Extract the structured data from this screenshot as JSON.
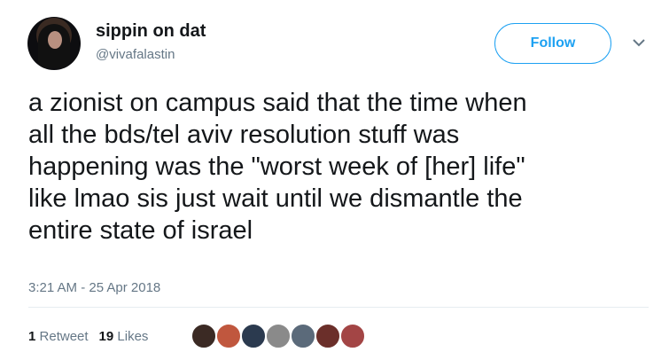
{
  "author": {
    "display_name": "sippin on dat",
    "handle": "@vivafalastin"
  },
  "follow_button": {
    "label": "Follow"
  },
  "tweet": {
    "text": "a zionist on campus said that the time when\nall the bds/tel aviv resolution stuff was\nhappening was the \"worst week of [her] life\"\nlike lmao sis just wait until we dismantle the\nentire state of israel",
    "timestamp": "3:21 AM - 25 Apr 2018"
  },
  "stats": {
    "retweets_count": "1",
    "retweets_label": "Retweet",
    "likes_count": "19",
    "likes_label": "Likes"
  },
  "likers": [
    {
      "name": "liker-avatar-1",
      "color": "#3b2a24"
    },
    {
      "name": "liker-avatar-2",
      "color": "#c0573e"
    },
    {
      "name": "liker-avatar-3",
      "color": "#2b3a4f"
    },
    {
      "name": "liker-avatar-4",
      "color": "#8a8a8a"
    },
    {
      "name": "liker-avatar-5",
      "color": "#5b6a7a"
    },
    {
      "name": "liker-avatar-6",
      "color": "#6b2f2a"
    },
    {
      "name": "liker-avatar-7",
      "color": "#a34545"
    }
  ],
  "colors": {
    "accent": "#1da1f2",
    "muted": "#657786",
    "text": "#14171a"
  },
  "icons": {
    "menu": "chevron-down-icon"
  }
}
